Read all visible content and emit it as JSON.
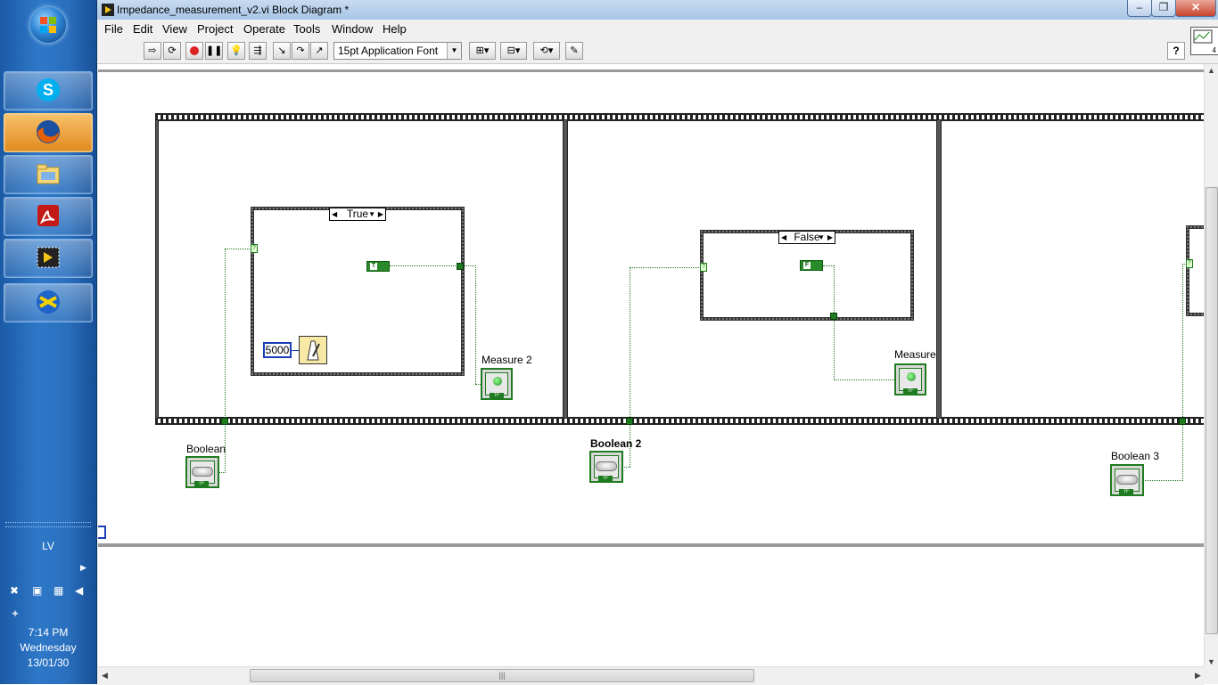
{
  "taskbar": {
    "apps": [
      {
        "name": "skype",
        "icon": "skype-icon"
      },
      {
        "name": "firefox",
        "icon": "firefox-icon",
        "active": true
      },
      {
        "name": "explorer",
        "icon": "folder-icon"
      },
      {
        "name": "acrobat",
        "icon": "pdf-icon"
      },
      {
        "name": "labview",
        "icon": "labview-icon"
      },
      {
        "name": "other",
        "icon": "globe-icon"
      }
    ],
    "tray": {
      "language": "LV",
      "time": "7:14 PM",
      "day": "Wednesday",
      "date": "13/01/30"
    }
  },
  "window": {
    "title": "Impedance_measurement_v2.vi Block Diagram *",
    "menu": [
      "File",
      "Edit",
      "View",
      "Project",
      "Operate",
      "Tools",
      "Window",
      "Help"
    ],
    "font_select": "15pt Application Font",
    "help": "?",
    "vi_icon_number": "4"
  },
  "diagram": {
    "case1_selector": "True",
    "case2_selector": "False",
    "const_value": "5000",
    "labels": {
      "measure2": "Measure 2",
      "measure": "Measure",
      "boolean": "Boolean",
      "boolean2": "Boolean 2",
      "boolean3": "Boolean 3"
    }
  },
  "colors": {
    "wire": "#1d7a1d",
    "taskbar": "#2e78c8",
    "titlebar": "#a9c5e6"
  }
}
